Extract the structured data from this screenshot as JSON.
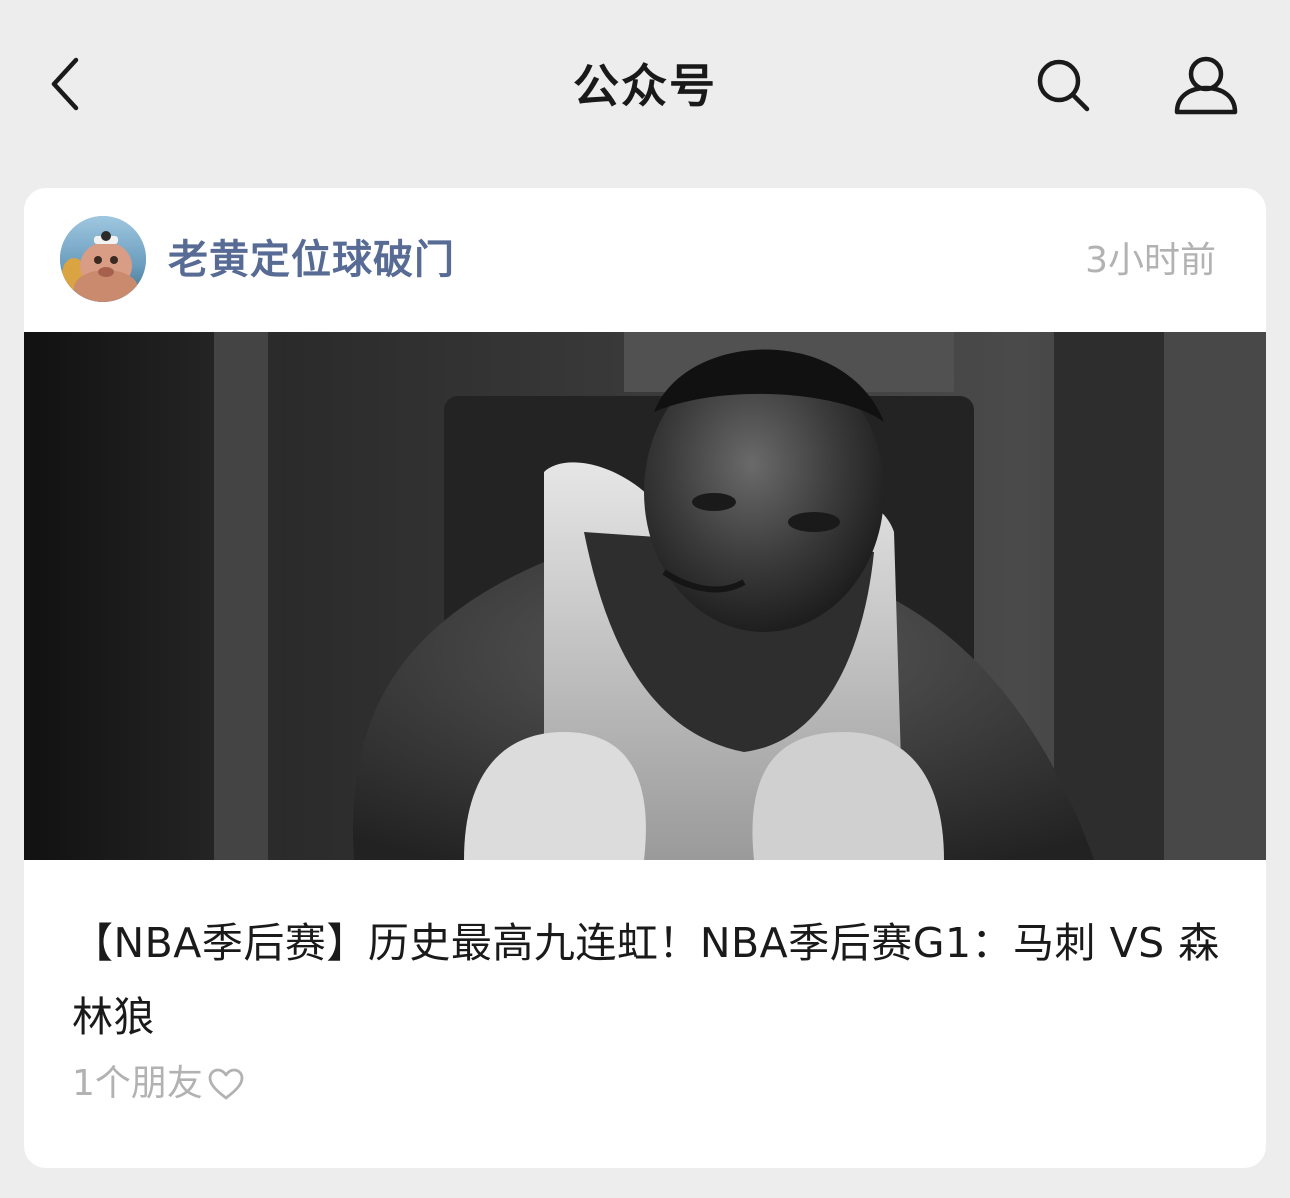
{
  "nav": {
    "title": "公众号",
    "icons": [
      "chevron-left-icon",
      "search-icon",
      "user-profile-icon"
    ]
  },
  "card": {
    "account_name": "老黄定位球破门",
    "timestamp": "3小时前",
    "title": "【NBA季后赛】历史最高九连虹！NBA季后赛G1：马刺 VS 森林狼",
    "friends_text": "1个朋友",
    "icons": [
      "heart-outline-icon"
    ]
  },
  "colors": {
    "background": "#ededed",
    "card": "#ffffff",
    "account_name": "#576b95",
    "muted": "#b2b2b2",
    "title": "#1a1a1a"
  }
}
